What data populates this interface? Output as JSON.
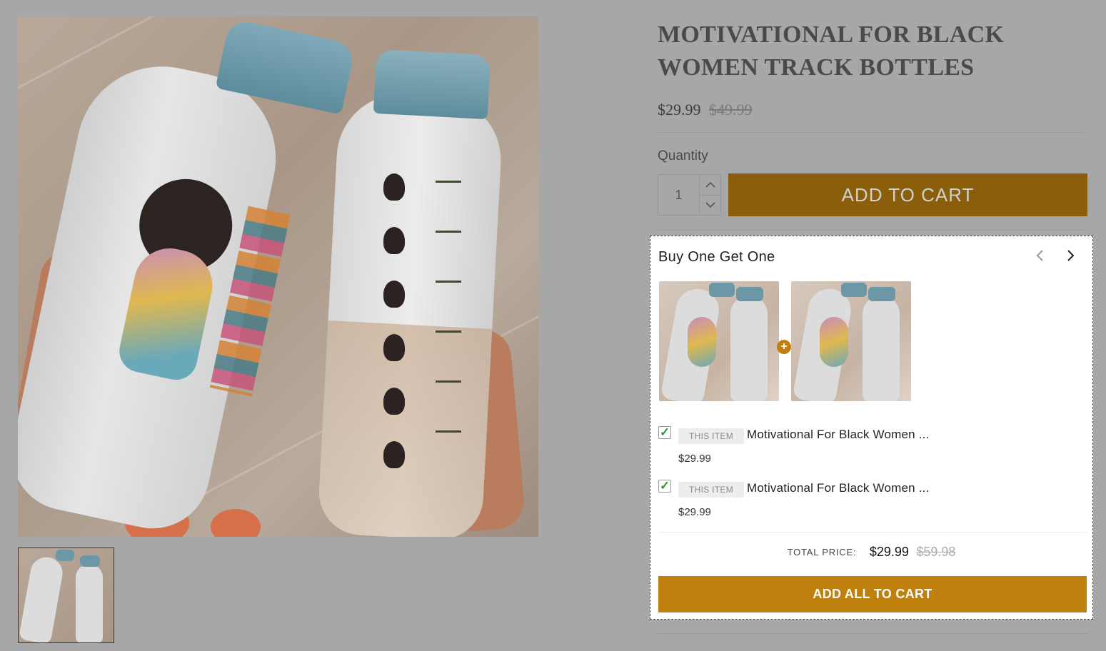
{
  "product": {
    "title": "MOTIVATIONAL FOR BLACK WOMEN TRACK BOTTLES",
    "price": "$29.99",
    "compare_price": "$49.99"
  },
  "quantity": {
    "label": "Quantity",
    "value": "1",
    "up_icon": "chevron-up-icon",
    "down_icon": "chevron-down-icon"
  },
  "add_to_cart_label": "ADD TO CART",
  "bogo": {
    "title": "Buy One Get One",
    "items": [
      {
        "badge": "THIS ITEM",
        "name": "Motivational For Black Women ...",
        "price": "$29.99",
        "checked": true
      },
      {
        "badge": "THIS ITEM",
        "name": "Motivational For Black Women ...",
        "price": "$29.99",
        "checked": true
      }
    ],
    "total_label": "TOTAL PRICE:",
    "total_price": "$29.99",
    "total_compare": "$59.98",
    "add_all_label": "ADD ALL TO CART"
  },
  "colors": {
    "primary_button": "#8b5e0c",
    "bogo_button": "#c0800e",
    "check": "#2a9d2a"
  }
}
